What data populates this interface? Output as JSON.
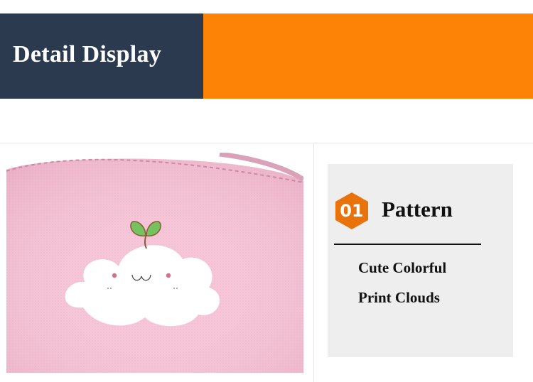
{
  "header": {
    "title": "Detail Display",
    "colors": {
      "dark": "#2b3a4f",
      "accent": "#fd8307"
    }
  },
  "photo": {
    "subject": "pink-canvas-cloud-print",
    "colors": {
      "canvas": "#f6c4d7",
      "cloud": "#ffffff",
      "sprout": "#76c25e"
    }
  },
  "feature": {
    "number": "01",
    "title": "Pattern",
    "description_lines": [
      "Cute Colorful",
      "Print Clouds"
    ],
    "badge_icon": "hexagon-badge",
    "colors": {
      "badge": "#e8730a",
      "card": "#eeeeee"
    }
  }
}
